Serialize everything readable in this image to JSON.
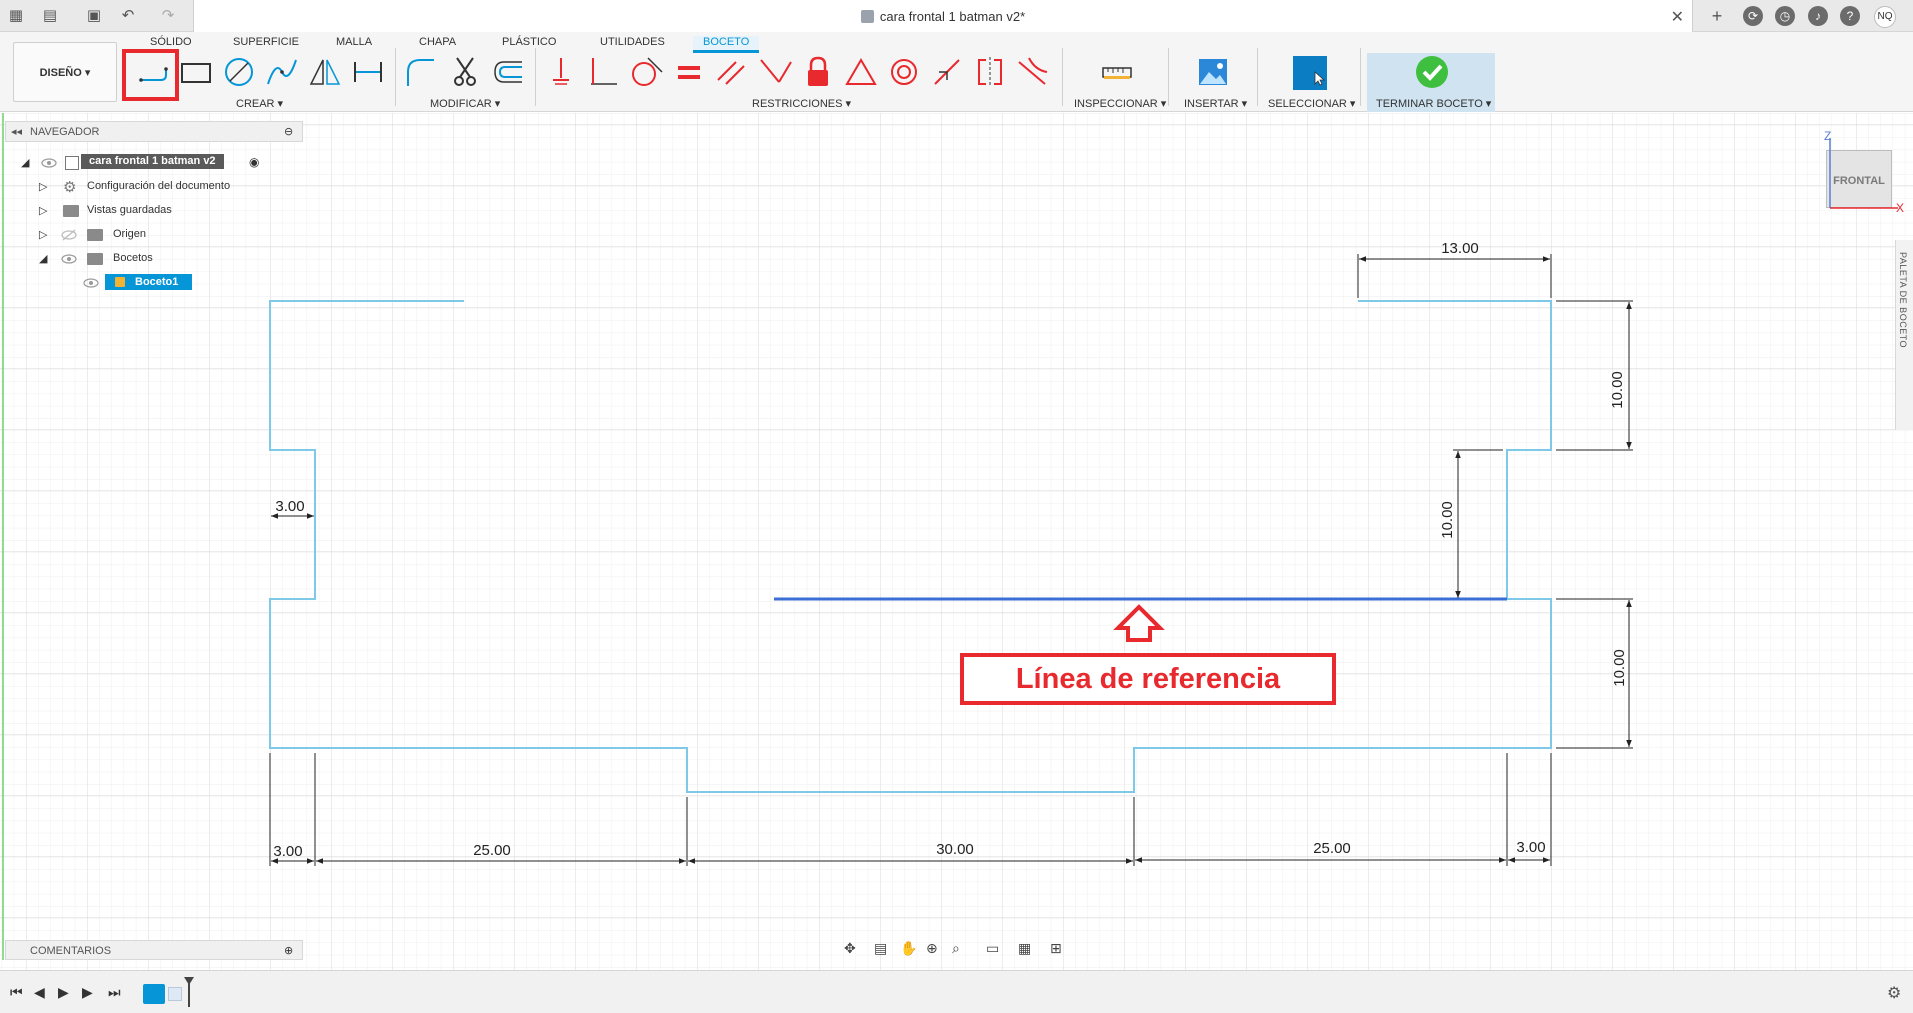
{
  "titlebar": {
    "document_title": "cara frontal 1 batman v2*"
  },
  "user": {
    "initials": "NQ"
  },
  "ribbon": {
    "tabs": [
      "SÓLIDO",
      "SUPERFICIE",
      "MALLA",
      "CHAPA",
      "PLÁSTICO",
      "UTILIDADES",
      "BOCETO"
    ],
    "active_tab": "BOCETO",
    "workspace": "DISEÑO ▾",
    "groups": {
      "create": "CREAR ▾",
      "modify": "MODIFICAR ▾",
      "constraints": "RESTRICCIONES ▾",
      "inspect": "INSPECCIONAR ▾",
      "insert": "INSERTAR ▾",
      "select": "SELECCIONAR ▾",
      "finish": "TERMINAR BOCETO ▾"
    }
  },
  "navigator": {
    "header": "NAVEGADOR",
    "root": "cara frontal 1 batman v2",
    "items": [
      {
        "label": "Configuración del documento",
        "icon": "gear-icon"
      },
      {
        "label": "Vistas guardadas",
        "icon": "folder-icon"
      },
      {
        "label": "Origen",
        "icon": "folder-icon"
      },
      {
        "label": "Bocetos",
        "icon": "folder-icon"
      }
    ],
    "sketch": "Boceto1"
  },
  "comments": {
    "header": "COMENTARIOS"
  },
  "palette": {
    "label": "PALETA DE BOCETO"
  },
  "viewcube": {
    "face": "FRONTAL",
    "axis_z": "Z",
    "axis_x": "X"
  },
  "sketch": {
    "dimensions": {
      "top_right_width": "13.00",
      "right_top_height": "10.00",
      "right_inner_height": "10.00",
      "right_bottom_height": "10.00",
      "left_notch_width": "3.00",
      "bottom_left_notch": "3.00",
      "bottom_left_span": "25.00",
      "bottom_center_span": "30.00",
      "bottom_right_span": "25.00",
      "bottom_right_notch": "3.00"
    },
    "annotation": "Línea de referencia",
    "colors": {
      "profile": "#7ec8e8",
      "reference": "#3b6fd6",
      "annotation": "#e8292e",
      "dimension": "#222222"
    }
  }
}
